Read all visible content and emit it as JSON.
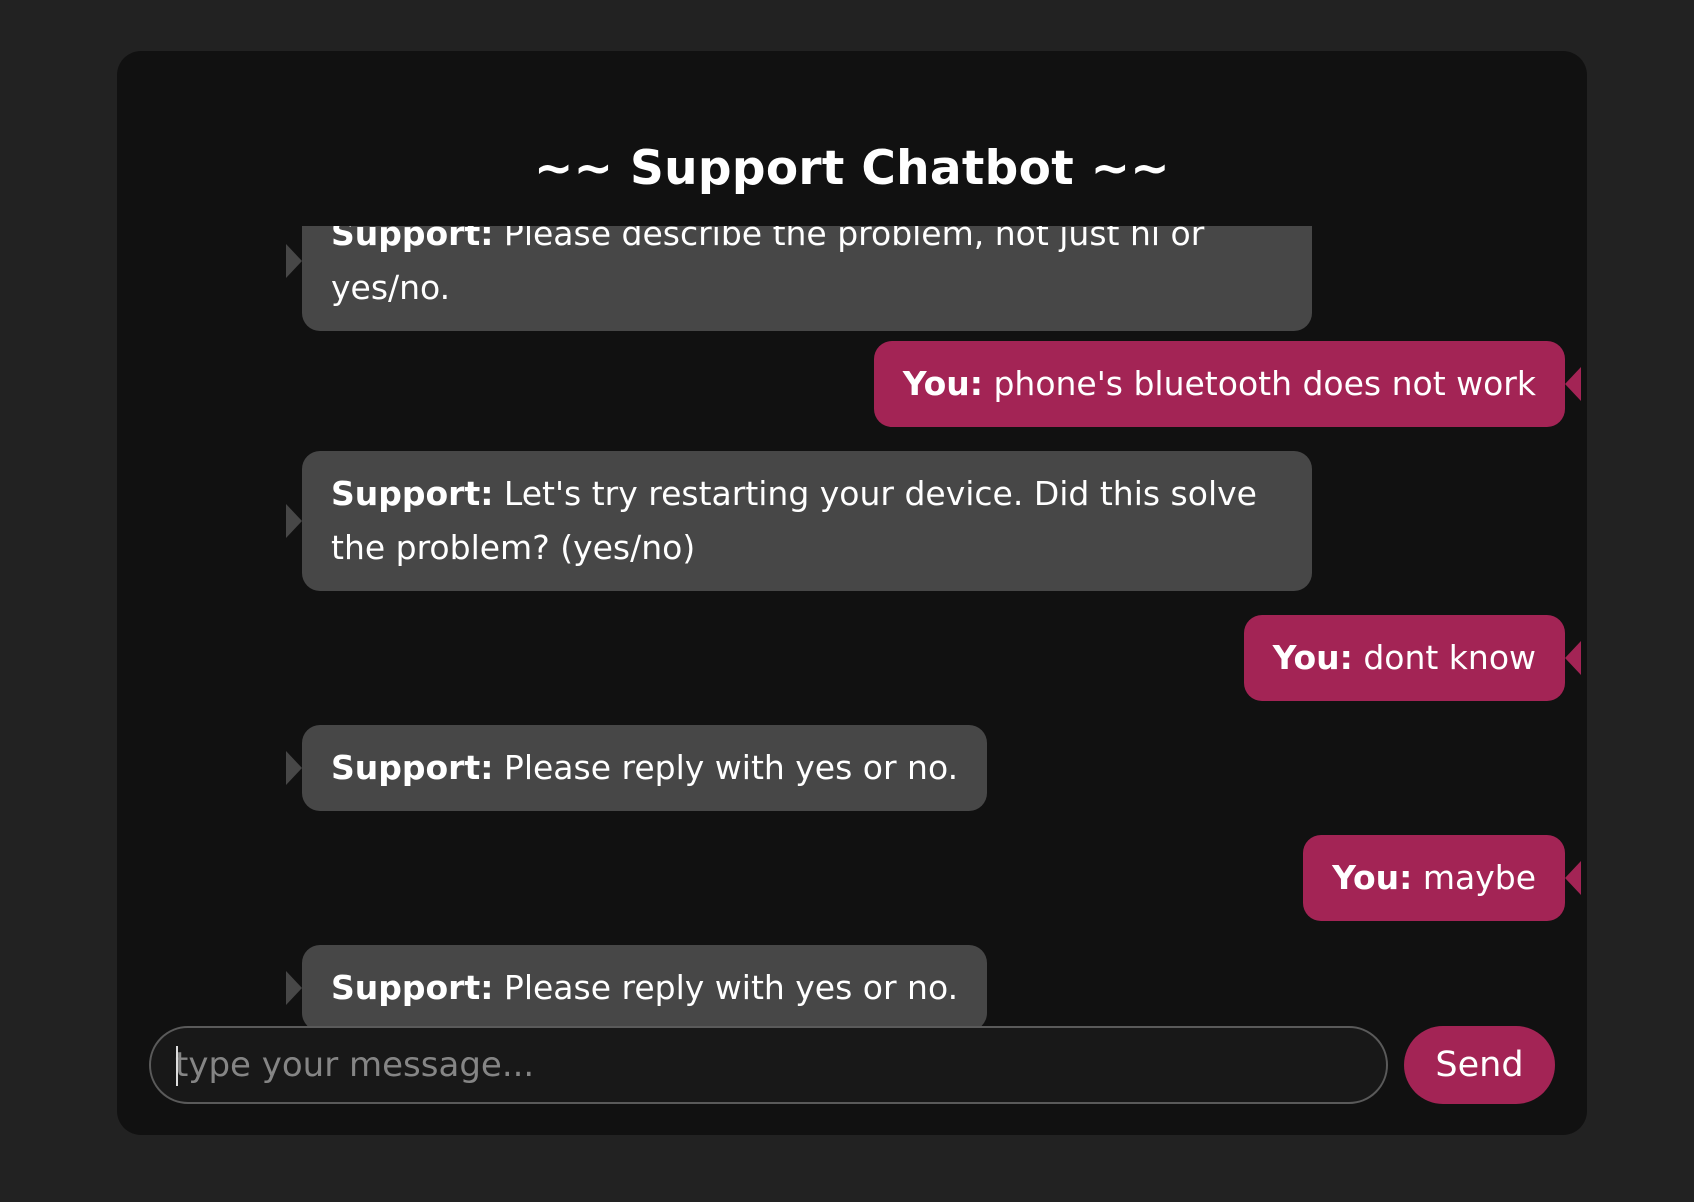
{
  "chat": {
    "title": "~~ Support Chatbot ~~",
    "messages": [
      {
        "sender": "Support:",
        "text": "Please describe the problem, not just hi or yes/no."
      },
      {
        "sender": "You:",
        "text": "phone's bluetooth does not work"
      },
      {
        "sender": "Support:",
        "text": "Let's try restarting your device. Did this solve the problem? (yes/no)"
      },
      {
        "sender": "You:",
        "text": "dont know"
      },
      {
        "sender": "Support:",
        "text": "Please reply with yes or no."
      },
      {
        "sender": "You:",
        "text": "maybe"
      },
      {
        "sender": "Support:",
        "text": "Please reply with yes or no."
      }
    ]
  },
  "composer": {
    "placeholder": "type your message...",
    "value": ""
  },
  "send_button": {
    "label": "Send"
  },
  "colors": {
    "page_background": "#222222",
    "window_background": "#111111",
    "support_bubble": "#474747",
    "user_bubble": "#a32455",
    "accent": "#a32455"
  }
}
